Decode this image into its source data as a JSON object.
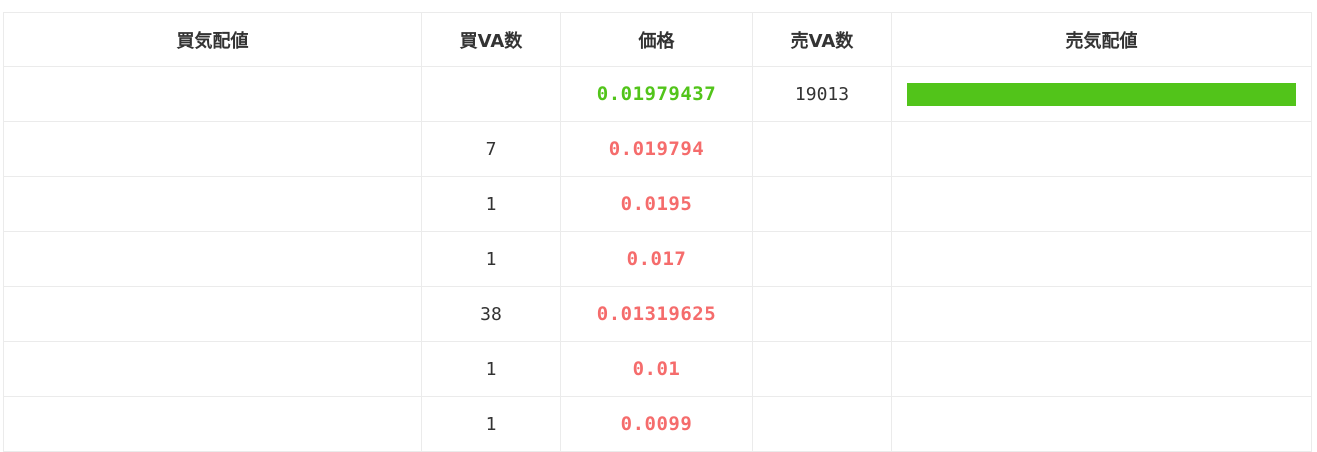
{
  "headers": {
    "buy_depth": "買気配値",
    "buy_qty": "買VA数",
    "price": "価格",
    "sell_qty": "売VA数",
    "sell_depth": "売気配値"
  },
  "colors": {
    "sell_price": "#52c41a",
    "buy_price": "#f56c6c",
    "sell_bar": "#52c41a"
  },
  "rows": [
    {
      "buy_qty": "",
      "price": "0.01979437",
      "side": "sell",
      "sell_qty": "19013",
      "sell_depth_fraction": 1.0,
      "buy_depth_fraction": 0
    },
    {
      "buy_qty": "7",
      "price": "0.019794",
      "side": "buy",
      "sell_qty": "",
      "sell_depth_fraction": 0,
      "buy_depth_fraction": 0
    },
    {
      "buy_qty": "1",
      "price": "0.0195",
      "side": "buy",
      "sell_qty": "",
      "sell_depth_fraction": 0,
      "buy_depth_fraction": 0
    },
    {
      "buy_qty": "1",
      "price": "0.017",
      "side": "buy",
      "sell_qty": "",
      "sell_depth_fraction": 0,
      "buy_depth_fraction": 0
    },
    {
      "buy_qty": "38",
      "price": "0.01319625",
      "side": "buy",
      "sell_qty": "",
      "sell_depth_fraction": 0,
      "buy_depth_fraction": 0
    },
    {
      "buy_qty": "1",
      "price": "0.01",
      "side": "buy",
      "sell_qty": "",
      "sell_depth_fraction": 0,
      "buy_depth_fraction": 0
    },
    {
      "buy_qty": "1",
      "price": "0.0099",
      "side": "buy",
      "sell_qty": "",
      "sell_depth_fraction": 0,
      "buy_depth_fraction": 0
    }
  ]
}
